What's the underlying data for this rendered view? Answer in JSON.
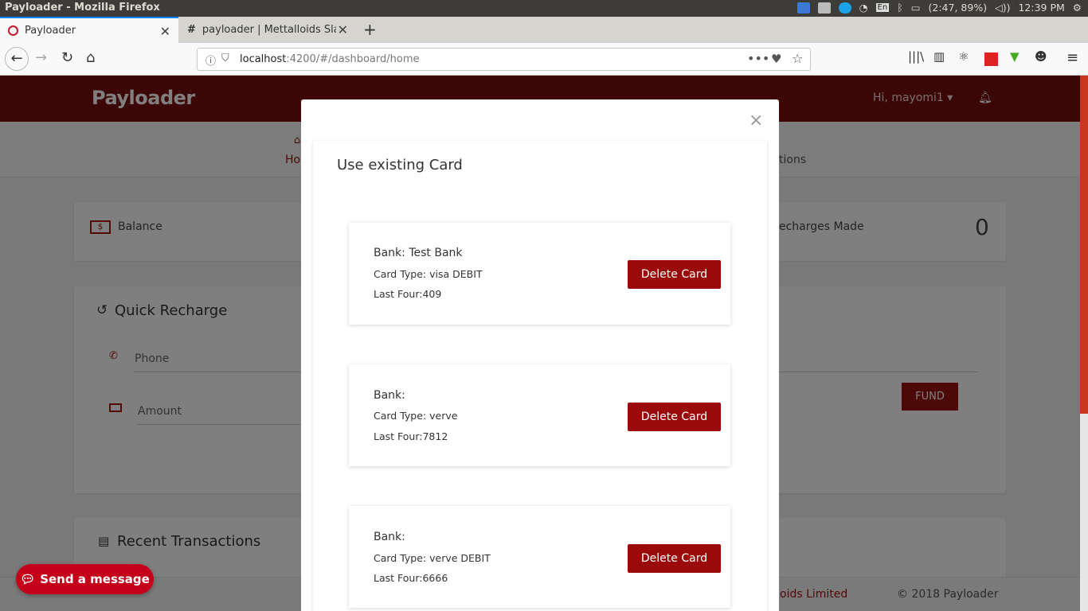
{
  "os": {
    "window_title": "Payloader - Mozilla Firefox",
    "keyboard": "En",
    "battery": "(2:47, 89%)",
    "time": "12:39 PM"
  },
  "browser": {
    "tabs": [
      {
        "label": "Payloader",
        "active": true
      },
      {
        "label": "payloader | Mettalloids Slac",
        "active": false
      }
    ],
    "url_host": "localhost",
    "url_rest": ":4200/#/dashboard/home"
  },
  "app": {
    "logo": "Payloader",
    "greeting": "Hi, mayomi1",
    "subnav": {
      "home": "Ho",
      "transactions": "tions"
    },
    "balance_label": "Balance",
    "recharges_label": "echarges Made",
    "recharges_value": "0",
    "quick_recharge_title": "Quick Recharge",
    "phone_placeholder": "Phone",
    "amount_placeholder": "Amount",
    "fund_label": "FUND",
    "recent_transactions_title": "Recent Transactions",
    "footer_company": "oids Limited",
    "footer_copyright": "© 2018 Payloader",
    "chat_label": "Send a message"
  },
  "modal": {
    "close_label": "×",
    "title": "Use existing Card",
    "cards": [
      {
        "bank": "Bank: Test Bank",
        "type": "Card Type: visa DEBIT",
        "last_four": "Last Four:409",
        "delete_label": "Delete Card"
      },
      {
        "bank": "Bank:",
        "type": "Card Type: verve",
        "last_four": "Last Four:7812",
        "delete_label": "Delete Card"
      },
      {
        "bank": "Bank:",
        "type": "Card Type: verve DEBIT",
        "last_four": "Last Four:6666",
        "delete_label": "Delete Card"
      }
    ]
  },
  "colors": {
    "brand": "#7a0c0c",
    "button": "#9b0a0a",
    "chat": "#c4001a"
  }
}
